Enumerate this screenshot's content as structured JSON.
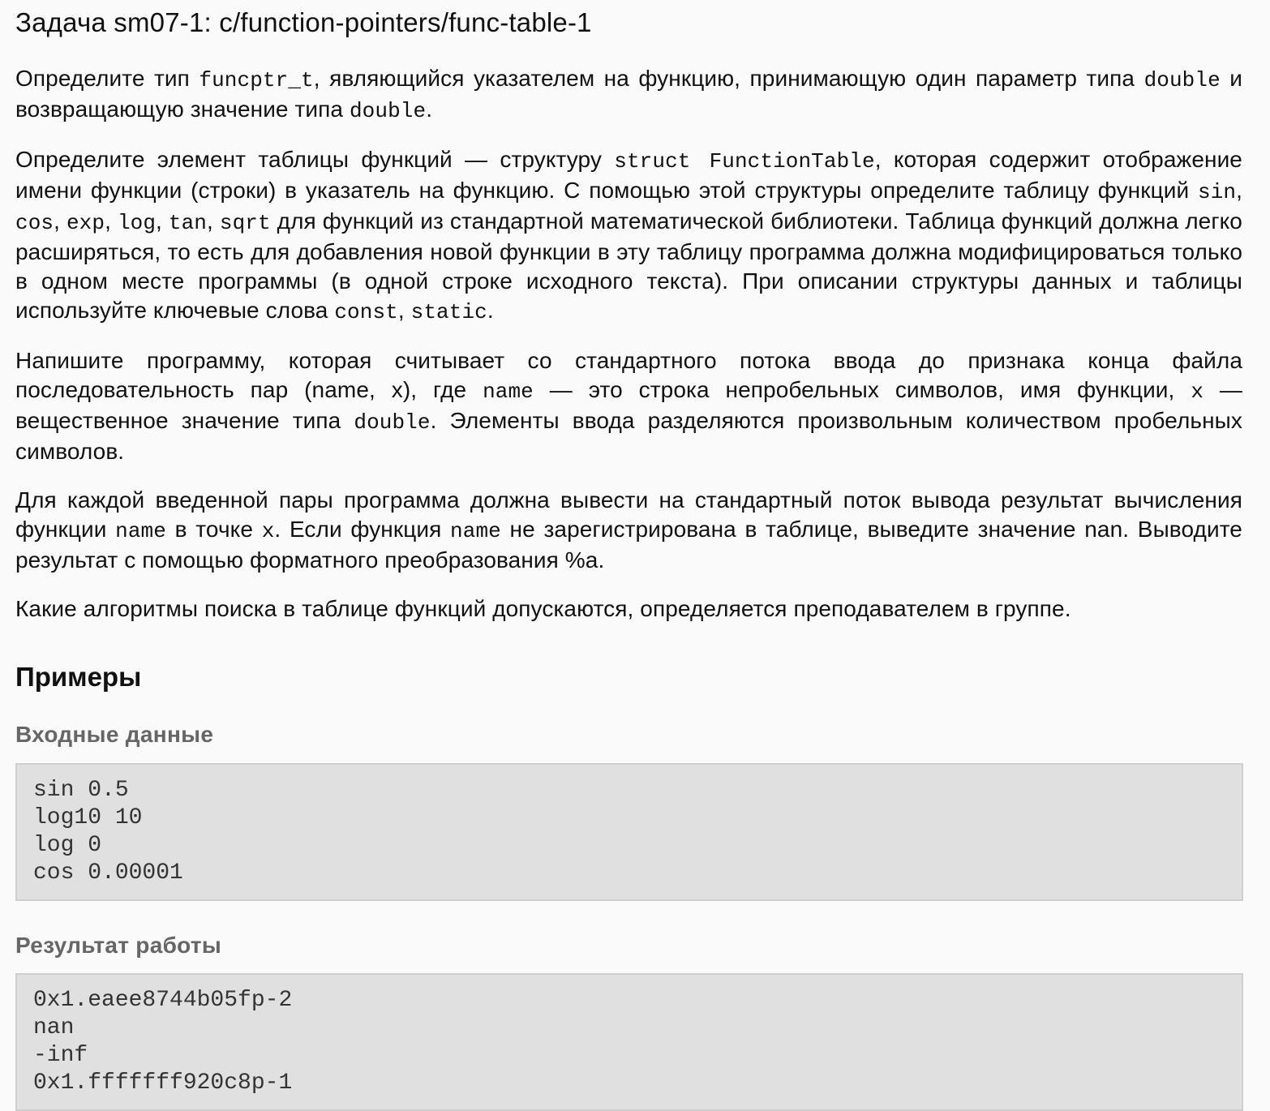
{
  "title": "Задача sm07-1: c/function-pointers/func-table-1",
  "paragraphs": {
    "p1": [
      {
        "t": "Определите тип "
      },
      {
        "c": "funcptr_t"
      },
      {
        "t": ", являющийся указателем на функцию, принимающую один параметр типа "
      },
      {
        "c": "double"
      },
      {
        "t": " и возвращающую значение типа "
      },
      {
        "c": "double"
      },
      {
        "t": "."
      }
    ],
    "p2": [
      {
        "t": "Определите элемент таблицы функций — структуру "
      },
      {
        "c": "struct FunctionTable"
      },
      {
        "t": ", которая содержит отображение имени функции (строки) в указатель на функцию. С помощью этой структуры определите таблицу функций "
      },
      {
        "c": "sin"
      },
      {
        "t": ", "
      },
      {
        "c": "cos"
      },
      {
        "t": ", "
      },
      {
        "c": "exp"
      },
      {
        "t": ", "
      },
      {
        "c": "log"
      },
      {
        "t": ", "
      },
      {
        "c": "tan"
      },
      {
        "t": ", "
      },
      {
        "c": "sqrt"
      },
      {
        "t": " для функций из стандартной математической библиотеки. Таблица функций должна легко расширяться, то есть для добавления новой функции в эту таблицу программа должна модифицироваться только в одном месте программы (в одной строке исходного текста). При описании структуры данных и таблицы используйте ключевые слова "
      },
      {
        "c": "const"
      },
      {
        "t": ", "
      },
      {
        "c": "static"
      },
      {
        "t": "."
      }
    ],
    "p3": [
      {
        "t": "Напишите программу, которая считывает со стандартного потока ввода до признака конца файла последовательность пар (name, x), где "
      },
      {
        "c": "name"
      },
      {
        "t": " — это строка непробельных символов, имя функции, "
      },
      {
        "c": "x"
      },
      {
        "t": " — вещественное значение типа "
      },
      {
        "c": "double"
      },
      {
        "t": ". Элементы ввода разделяются произвольным количеством пробельных символов."
      }
    ],
    "p4": [
      {
        "t": "Для каждой введенной пары программа должна вывести на стандартный поток вывода результат вычисления функции "
      },
      {
        "c": "name"
      },
      {
        "t": " в точке "
      },
      {
        "c": "x"
      },
      {
        "t": ". Если функция "
      },
      {
        "c": "name"
      },
      {
        "t": " не зарегистрирована в таблице, выведите значение nan. Выводите результат с помощью форматного преобразования %a."
      }
    ],
    "p5": [
      {
        "t": "Какие алгоритмы поиска в таблице функций допускаются, определяется преподавателем в группе."
      }
    ]
  },
  "examples": {
    "heading": "Примеры",
    "input_heading": "Входные данные",
    "input_lines": [
      "sin 0.5",
      "log10 10",
      "log 0",
      "cos 0.00001"
    ],
    "output_heading": "Результат работы",
    "output_lines": [
      "0x1.eaee8744b05fp-2",
      "nan",
      "-inf",
      "0x1.fffffff920c8p-1"
    ]
  }
}
